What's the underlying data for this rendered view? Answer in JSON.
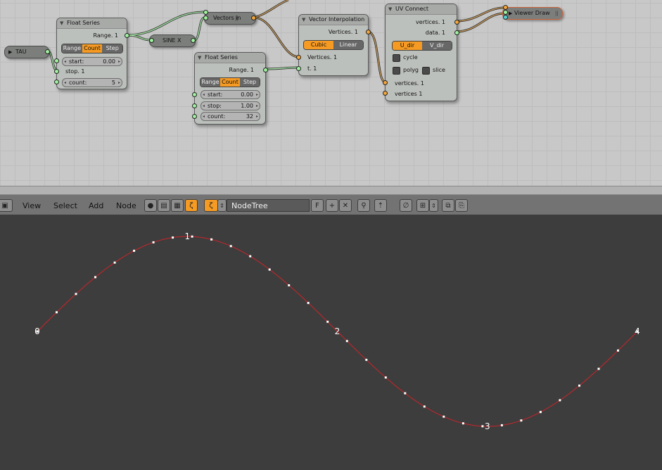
{
  "node_editor": {
    "nodes": {
      "tau": {
        "label": "TAU"
      },
      "float_series_1": {
        "title": "Float Series",
        "output": "Range. 1",
        "modes": [
          "Range",
          "Count",
          "Step"
        ],
        "active_mode": "Count",
        "start_label": "start:",
        "start_value": "0.00",
        "stop_label": "stop. 1",
        "count_label": "count:",
        "count_value": "5"
      },
      "sine_x": {
        "label": "SINE X"
      },
      "vectors_in": {
        "label": "Vectors in"
      },
      "float_series_2": {
        "title": "Float Series",
        "output": "Range. 1",
        "modes": [
          "Range",
          "Count",
          "Step"
        ],
        "active_mode": "Count",
        "start_label": "start:",
        "start_value": "0.00",
        "stop_label": "stop:",
        "stop_value": "1.00",
        "count_label": "count:",
        "count_value": "32"
      },
      "vector_interp": {
        "title": "Vector Interpolation",
        "output": "Vertices. 1",
        "modes": [
          "Cubic",
          "Linear"
        ],
        "active_mode": "Cubic",
        "in_vertices": "Vertices. 1",
        "in_t": "t. 1"
      },
      "uv_connect": {
        "title": "UV Connect",
        "out_vertices": "vertices. 1",
        "out_data": "data. 1",
        "dirs": [
          "U_dir",
          "V_dir"
        ],
        "active_dir": "U_dir",
        "cycle_label": "cycle",
        "polyg_label": "polyg",
        "slice_label": "slice",
        "in_vertices_1": "vertices. 1",
        "in_vertices_2": "vertices 1"
      },
      "viewer_draw": {
        "label": "Viewer Draw"
      }
    },
    "colors": {
      "socket_float": "#9ef29e",
      "socket_vector": "#f4a63a",
      "socket_color": "#56d4d4",
      "active_button": "#f59a22"
    }
  },
  "header": {
    "menus": [
      "View",
      "Select",
      "Add",
      "Node"
    ],
    "tree_name": "NodeTree",
    "fake_user": "F",
    "icons": [
      "editor-type-icon",
      "material-icon",
      "texture-icon",
      "compositing-icon",
      "sverchok-icon",
      "plus-icon",
      "close-icon",
      "pin-icon",
      "parent-icon",
      "snap-icon",
      "snap-element-icon",
      "copy-icon",
      "paste-icon"
    ]
  },
  "viewport": {
    "vertex_labels": [
      "0",
      "1",
      "2",
      "3",
      "4"
    ],
    "curve": {
      "samples": 32,
      "range": [
        0,
        6.2832
      ],
      "function": "sin"
    },
    "colors": {
      "curve": "#c0262b",
      "background": "#3d3d3d",
      "labels": "#ffffff"
    }
  }
}
